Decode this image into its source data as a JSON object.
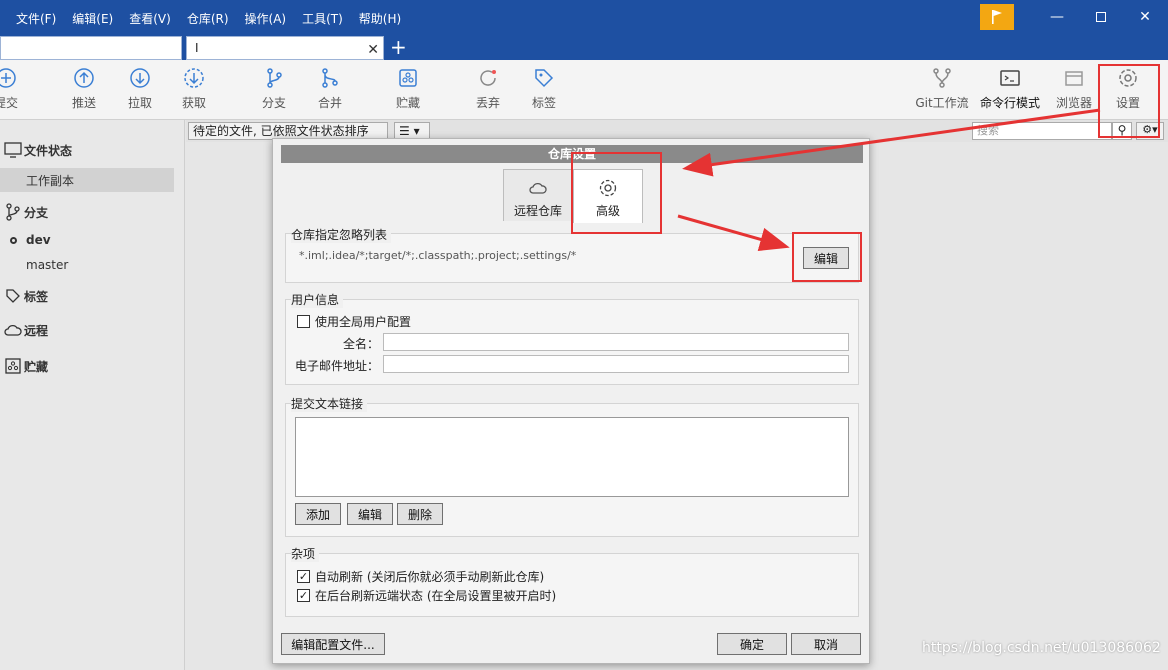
{
  "menu": [
    "文件(F)",
    "编辑(E)",
    "查看(V)",
    "仓库(R)",
    "操作(A)",
    "工具(T)",
    "帮助(H)"
  ],
  "tabs": [
    {
      "label": ""
    },
    {
      "label": "I"
    }
  ],
  "toolbar": {
    "left": [
      {
        "label": "提交",
        "icon": "plus-circle-icon"
      },
      {
        "label": "推送",
        "icon": "arrow-up-circle-icon"
      },
      {
        "label": "拉取",
        "icon": "arrow-down-circle-icon"
      },
      {
        "label": "获取",
        "icon": "fetch-icon"
      },
      {
        "label": "分支",
        "icon": "branch-icon"
      },
      {
        "label": "合并",
        "icon": "merge-icon"
      },
      {
        "label": "贮藏",
        "icon": "stash-icon"
      },
      {
        "label": "丢弃",
        "icon": "discard-icon"
      },
      {
        "label": "标签",
        "icon": "tag-icon"
      }
    ],
    "right": [
      {
        "label": "Git工作流",
        "icon": "gitflow-icon"
      },
      {
        "label": "命令行模式",
        "icon": "terminal-icon"
      },
      {
        "label": "浏览器",
        "icon": "browser-icon"
      },
      {
        "label": "设置",
        "icon": "gear-icon"
      }
    ]
  },
  "sidebar": {
    "file_status": "文件状态",
    "working_copy": "工作副本",
    "branches": "分支",
    "branch_dev": "dev",
    "branch_master": "master",
    "tags": "标签",
    "remotes": "远程",
    "stashes": "贮藏"
  },
  "sortbar": {
    "sort_label": "待定的文件, 已依照文件状态排序",
    "search_placeholder": "搜索"
  },
  "dialog": {
    "title": "仓库设置",
    "tab_remote": "远程仓库",
    "tab_advanced": "高级",
    "ignore_group": "仓库指定忽略列表",
    "ignore_value": "*.iml;.idea/*;target/*;.classpath;.project;.settings/*",
    "edit_button": "编辑",
    "user_group": "用户信息",
    "use_global": "使用全局用户配置",
    "fullname_label": "全名：",
    "email_label": "电子邮件地址：",
    "fullname_value": "",
    "email_value": "",
    "commit_links_group": "提交文本链接",
    "add_button": "添加",
    "edit_link_button": "编辑",
    "delete_button": "删除",
    "misc_group": "杂项",
    "auto_refresh": "自动刷新 (关闭后你就必须手动刷新此仓库)",
    "bg_refresh": "在后台刷新远端状态 (在全局设置里被开启时)",
    "edit_config_button": "编辑配置文件...",
    "ok_button": "确定",
    "cancel_button": "取消"
  },
  "watermark": "https://blog.csdn.net/u013086062",
  "colors": {
    "titlebar": "#1e50a2",
    "accent": "#e53333",
    "flag": "#f3a712"
  }
}
